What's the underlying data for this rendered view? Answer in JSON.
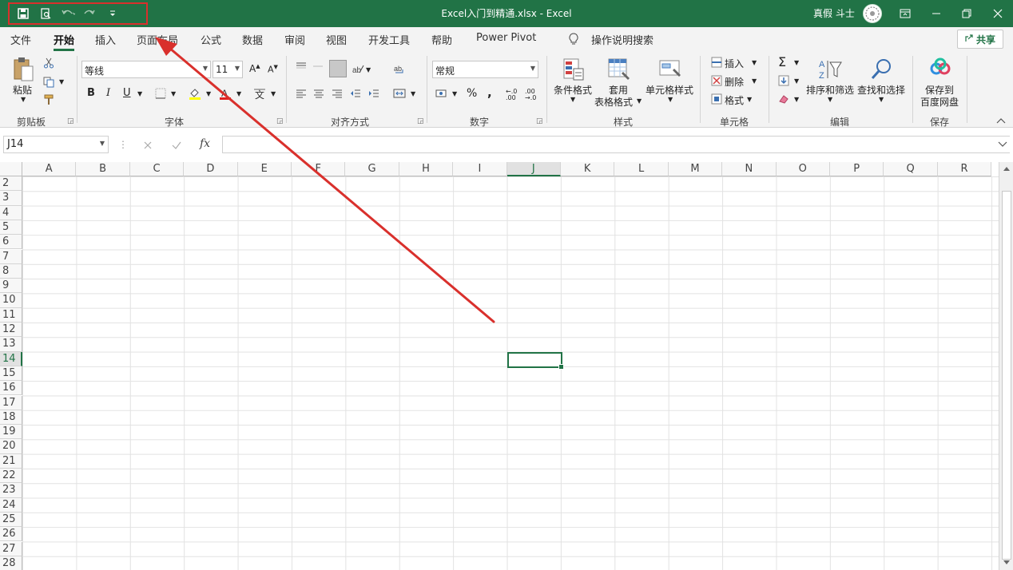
{
  "window": {
    "title": "Excel入门到精通.xlsx  -  Excel",
    "user_name": "真假 斗士"
  },
  "ribbon_tabs": [
    "文件",
    "开始",
    "插入",
    "页面布局",
    "公式",
    "数据",
    "审阅",
    "视图",
    "开发工具",
    "帮助",
    "Power Pivot"
  ],
  "active_tab": "开始",
  "tell_me": "操作说明搜索",
  "share_label": "共享",
  "clipboard": {
    "paste": "粘贴",
    "label": "剪贴板"
  },
  "font": {
    "name": "等线",
    "size": "11",
    "bold": "B",
    "italic": "I",
    "underline": "U",
    "label": "字体"
  },
  "alignment": {
    "label": "对齐方式"
  },
  "number": {
    "format": "常规",
    "percent": "%",
    "comma": ",",
    "label": "数字"
  },
  "styles": {
    "conditional": "条件格式",
    "table_line1": "套用",
    "table_line2": "表格格式",
    "cell_styles": "单元格样式",
    "label": "样式"
  },
  "cells_group": {
    "insert": "插入",
    "delete": "删除",
    "format": "格式",
    "label": "单元格"
  },
  "editing": {
    "sort_filter": "排序和筛选",
    "find_select": "查找和选择",
    "label": "编辑"
  },
  "save": {
    "line1": "保存到",
    "line2": "百度网盘",
    "label": "保存"
  },
  "formula_bar": {
    "name_box": "J14",
    "fx": "fx",
    "value": ""
  },
  "columns": [
    "A",
    "B",
    "C",
    "D",
    "E",
    "F",
    "G",
    "H",
    "I",
    "J",
    "K",
    "L",
    "M",
    "N",
    "O",
    "P",
    "Q",
    "R"
  ],
  "rows": [
    "2",
    "3",
    "4",
    "5",
    "6",
    "7",
    "8",
    "9",
    "10",
    "11",
    "12",
    "13",
    "14",
    "15",
    "16",
    "17",
    "18",
    "19",
    "20",
    "21",
    "22",
    "23",
    "24",
    "25",
    "26",
    "27",
    "28"
  ],
  "selected_cell": {
    "column": "J",
    "row": "14"
  },
  "colors": {
    "accent": "#217346",
    "annotation": "#d9302c"
  }
}
